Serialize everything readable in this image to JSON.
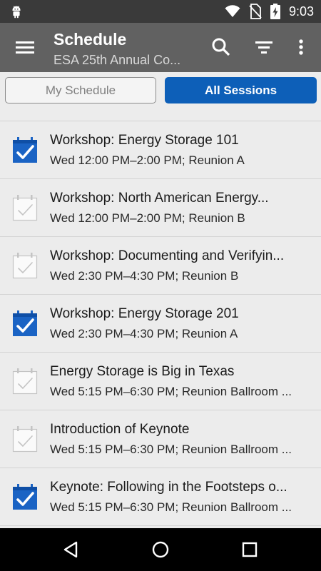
{
  "status_bar": {
    "time": "9:03",
    "icons": [
      "android-icon",
      "wifi-icon",
      "no-sim-icon",
      "battery-charging-icon"
    ]
  },
  "app_bar": {
    "title": "Schedule",
    "subtitle": "ESA 25th Annual Co...",
    "actions": [
      "menu-icon",
      "search-icon",
      "filter-icon",
      "more-vert-icon"
    ]
  },
  "segments": {
    "my_schedule": "My Schedule",
    "all_sessions": "All Sessions",
    "active": "all_sessions",
    "active_color": "#0d5fb8"
  },
  "sessions": [
    {
      "title": "Workshop: Energy Storage 101",
      "time": "Wed 12:00 PM–2:00 PM; Reunion A",
      "checked": true
    },
    {
      "title": "Workshop: North American Energy...",
      "time": "Wed 12:00 PM–2:00 PM; Reunion B",
      "checked": false
    },
    {
      "title": "Workshop: Documenting and Verifyin...",
      "time": "Wed 2:30 PM–4:30 PM; Reunion B",
      "checked": false
    },
    {
      "title": "Workshop: Energy Storage 201",
      "time": "Wed 2:30 PM–4:30 PM; Reunion A",
      "checked": true
    },
    {
      "title": "Energy Storage is Big in Texas",
      "time": "Wed 5:15 PM–6:30 PM; Reunion Ballroom ...",
      "checked": false
    },
    {
      "title": "Introduction of Keynote",
      "time": "Wed 5:15 PM–6:30 PM; Reunion Ballroom ...",
      "checked": false
    },
    {
      "title": "Keynote: Following in the Footsteps o...",
      "time": "Wed 5:15 PM–6:30 PM; Reunion Ballroom ...",
      "checked": true
    }
  ],
  "nav_bar": [
    "back-icon",
    "home-icon",
    "recents-icon"
  ]
}
